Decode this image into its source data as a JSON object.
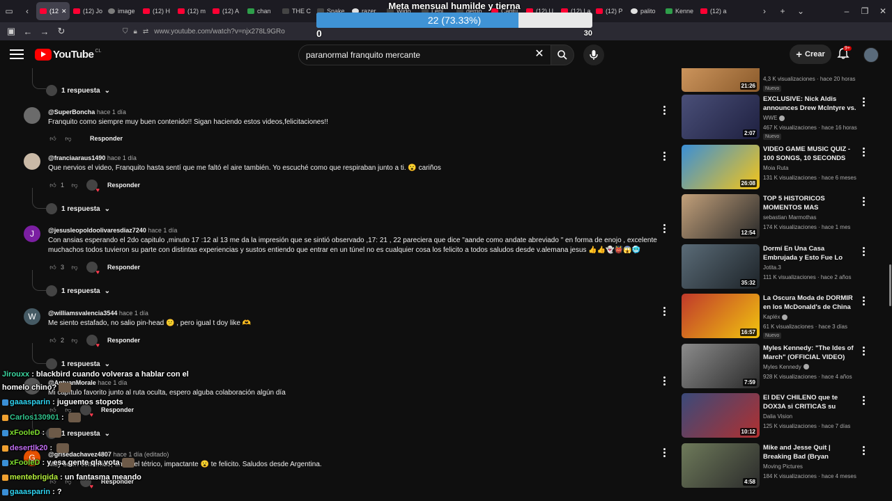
{
  "browser": {
    "tabs": [
      {
        "label": "(12"
      },
      {
        "label": "(12) Jo"
      },
      {
        "label": "image"
      },
      {
        "label": "(12) H"
      },
      {
        "label": "(12) m"
      },
      {
        "label": "(12) A"
      },
      {
        "label": "chan"
      },
      {
        "label": "THE C"
      },
      {
        "label": "Snake"
      },
      {
        "label": "razer"
      },
      {
        "label": "Wido"
      },
      {
        "label": "Lenl"
      },
      {
        "label": "demo"
      },
      {
        "label": "Captu"
      },
      {
        "label": "(12) U"
      },
      {
        "label": "(12) La"
      },
      {
        "label": "(12) P"
      },
      {
        "label": "palito"
      },
      {
        "label": "Kenne"
      },
      {
        "label": "(12) a"
      }
    ],
    "url": "www.youtube.com/watch?v=njx278L9GRo",
    "extension_badge": "558"
  },
  "goal_widget": {
    "title": "Meta mensual humilde y tierna",
    "progress_text": "22 (73.33%)",
    "progress": 0.7333,
    "min": "0",
    "max": "30"
  },
  "youtube": {
    "logo_text": "YouTube",
    "country": "CL",
    "search_query": "paranormal franquito mercante",
    "create_label": "Crear",
    "notification_count": "9+"
  },
  "comments": [
    {
      "type": "replies",
      "label": "1 respuesta"
    },
    {
      "user": "@SuperBoncha",
      "time": "hace 1 día",
      "text": "Franquito como siempre muy buen contenido!! Sigan haciendo estos videos,felicitaciones!!",
      "likes": "",
      "reply_label": "Responder",
      "avatar_color": "#6b6b6b",
      "avatar_letter": ""
    },
    {
      "user": "@franciaaraus1490",
      "time": "hace 1 día",
      "text": "Que nervios el video, Franquito hasta sentí que me faltó el aire también. Yo escuché como que respiraban junto a ti. 😮 cariños",
      "likes": "1",
      "reply_label": "Responder",
      "replies_label": "1 respuesta",
      "avatar_color": "#c9b9a6",
      "avatar_letter": ""
    },
    {
      "user": "@jesusleopoldoolivaresdiaz7240",
      "time": "hace 1 día",
      "text": "Con ansias esperando el 2do capitulo ,minuto 17 :12 al 13 me da la impresión que se sintió observado ,17: 21 , 22 pareciera que dice \"aande como andate abreviado \" en forma de enojo , excelente muchachos todos tuvieron su parte con distintas experiencias y sustos entiendo que entrar en un túnel no es cualquier cosa los felicito a todos saludos desde v.alemana jesus 👍👍👻👹😱🥶",
      "likes": "3",
      "reply_label": "Responder",
      "replies_label": "1 respuesta",
      "avatar_color": "#7b1fa2",
      "avatar_letter": "J"
    },
    {
      "user": "@williamsvalencia3544",
      "time": "hace 1 día",
      "text": "Me siento estafado, no salio pin-head 😕 , pero igual t doy like 🫶",
      "likes": "2",
      "reply_label": "Responder",
      "replies_label": "1 respuesta",
      "avatar_color": "#455a64",
      "avatar_letter": "W"
    },
    {
      "user": "@AntuanMorale",
      "time": "hace 1 día",
      "text": "Mi capítulo favorito junto al ruta oculta, espero alguba colaboración algún día",
      "likes": "",
      "reply_label": "Responder",
      "replies_label": "1 respuesta",
      "avatar_color": "#555",
      "avatar_letter": ""
    },
    {
      "user": "@grisedachavez4807",
      "time": "hace 1 día (editado)",
      "text": "Muy buen contenido, un túnel tétrico, impactante 😮 te felicito. Saludos desde Argentina.",
      "likes": "",
      "reply_label": "Responder",
      "avatar_color": "#e65100",
      "avatar_letter": "G"
    }
  ],
  "sidebar": {
    "videos": [
      {
        "title": "",
        "channel": "",
        "meta": "4,3 K visualizaciones · hace 20 horas",
        "badge": "Nuevo",
        "duration": "21:26",
        "thumb_colors": [
          "#d9a066",
          "#8a5a2b"
        ]
      },
      {
        "title": "EXCLUSIVE: Nick Aldis announces Drew McIntyre vs. ...",
        "channel": "WWE",
        "meta": "467 K visualizaciones · hace 16 horas",
        "badge": "Nuevo",
        "duration": "2:07",
        "thumb_colors": [
          "#4a4f78",
          "#1e2040"
        ]
      },
      {
        "title": "VIDEO GAME MUSIC QUIZ - 100 SONGS, 10 SECONDS EACH",
        "channel": "Moia Ruta",
        "meta": "131 K visualizaciones · hace 6 meses",
        "badge": "",
        "duration": "26:08",
        "thumb_colors": [
          "#3a8fd6",
          "#f5c518"
        ]
      },
      {
        "title": "TOP 5 HISTORICOS MOMENTOS MAS INCOMODO...",
        "channel": "sebastian Marmothas",
        "meta": "174 K visualizaciones · hace 1 mes",
        "badge": "",
        "duration": "12:54",
        "thumb_colors": [
          "#c2a07a",
          "#2a2a2a"
        ]
      },
      {
        "title": "Dormí En Una Casa Embrujada y Esto Fue Lo Que Paso l ...",
        "channel": "Jotita.3",
        "meta": "111 K visualizaciones · hace 2 años",
        "badge": "",
        "duration": "35:32",
        "thumb_colors": [
          "#5a6b77",
          "#1d2328"
        ]
      },
      {
        "title": "La Oscura Moda de DORMIR en los McDonald's de China",
        "channel": "Kapléx",
        "meta": "61 K visualizaciones · hace 3 días",
        "badge": "Nuevo",
        "duration": "16:57",
        "thumb_colors": [
          "#c0392b",
          "#f1c40f"
        ]
      },
      {
        "title": "Myles Kennedy: \"The Ides of March\" (OFFICIAL VIDEO)",
        "channel": "Myles Kennedy",
        "meta": "928 K visualizaciones · hace 4 años",
        "badge": "",
        "duration": "7:59",
        "thumb_colors": [
          "#8b8b8b",
          "#2a2a2a"
        ]
      },
      {
        "title": "El DEV CHILENO que te DOX3A si CRITICAS su JUEGO | Villa d...",
        "channel": "Dalia Vision",
        "meta": "125 K visualizaciones · hace 7 días",
        "badge": "",
        "duration": "10:12",
        "thumb_colors": [
          "#3a4a7a",
          "#b03030"
        ]
      },
      {
        "title": "Mike and Jesse Quit | Breaking Bad (Bryan Cranston, Aaron ...",
        "channel": "Moving Pictures",
        "meta": "184 K visualizaciones · hace 4 meses",
        "badge": "",
        "duration": "4:58",
        "thumb_colors": [
          "#6e7a5a",
          "#2b2b2b"
        ]
      }
    ]
  },
  "chat": [
    {
      "user": "Jirouxx",
      "user_color": "#3cd6a0",
      "text": "blackbird cuando volveras a hablar con el",
      "emote": false
    },
    {
      "user": "",
      "user_color": "#ffffff",
      "text": "homelo chino?",
      "emote": true
    },
    {
      "user": "gaaasparin",
      "user_color": "#2fd3f0",
      "text": "juguemos stopots",
      "emote": false
    },
    {
      "user": "Carlos130901",
      "user_color": "#31c48d",
      "text": "",
      "emote": true
    },
    {
      "user": "xFooleD",
      "user_color": "#7ddc2e",
      "text": "",
      "emote": true
    },
    {
      "user": "desertlk20",
      "user_color": "#c06cf0",
      "text": "",
      "emote": true
    },
    {
      "user": "xFooleD",
      "user_color": "#7ddc2e",
      "text": "y esa gente qla vota",
      "emote": true
    },
    {
      "user": "mentebrigida",
      "user_color": "#b5f03c",
      "text": "un fantasma meando",
      "emote": false
    },
    {
      "user": "gaaasparin",
      "user_color": "#2fd3f0",
      "text": "?",
      "emote": false
    }
  ],
  "colors": {
    "accent": "#ff0000",
    "goal_fill": "#3f93d6",
    "background": "#0f0f0f"
  }
}
